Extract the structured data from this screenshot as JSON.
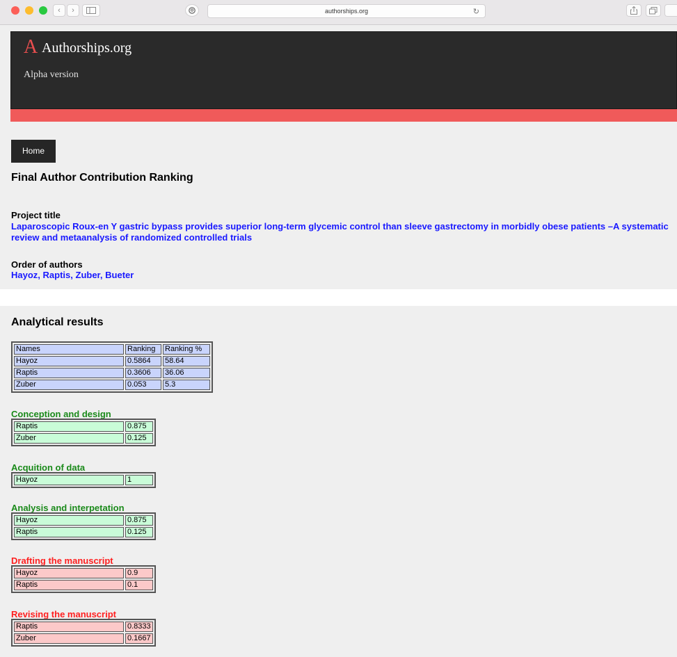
{
  "browser": {
    "url": "authorships.org",
    "nav_back": "‹",
    "nav_forward": "›",
    "reload_glyph": "↻",
    "colors": {
      "red": "#fc5f58",
      "yellow": "#fdbc2e",
      "green": "#29c940"
    }
  },
  "header": {
    "logo_letter": "A",
    "site_name": "Authorships.org",
    "subtitle": "Alpha version",
    "accent": "#f05a5a"
  },
  "nav": {
    "home_label": "Home"
  },
  "page": {
    "title": "Final Author Contribution Ranking",
    "project_label": "Project title",
    "project_title": "Laparoscopic Roux-en Y gastric bypass provides superior long-term glycemic control than sleeve gastrectomy in morbidly obese patients –A systematic review and metaanalysis of randomized controlled trials",
    "order_label": "Order of authors",
    "authors": [
      "Hayoz",
      "Raptis",
      "Zuber",
      "Bueter"
    ]
  },
  "results": {
    "title": "Analytical results",
    "ranking": {
      "headers": [
        "Names",
        "Ranking",
        "Ranking %"
      ],
      "rows": [
        [
          "Hayoz",
          "0.5864",
          "58.64"
        ],
        [
          "Raptis",
          "0.3606",
          "36.06"
        ],
        [
          "Zuber",
          "0.053",
          "5.3"
        ]
      ]
    },
    "sections": [
      {
        "title": "Conception and design",
        "rows": [
          [
            "Raptis",
            "0.875"
          ],
          [
            "Zuber",
            "0.125"
          ]
        ]
      },
      {
        "title": "Acquition of data",
        "rows": [
          [
            "Hayoz",
            "1"
          ]
        ]
      },
      {
        "title": "Analysis and interpetation",
        "rows": [
          [
            "Hayoz",
            "0.875"
          ],
          [
            "Raptis",
            "0.125"
          ]
        ]
      },
      {
        "title": "Drafting the manuscript",
        "rows": [
          [
            "Hayoz",
            "0.9"
          ],
          [
            "Raptis",
            "0.1"
          ]
        ]
      },
      {
        "title": "Revising the manuscript",
        "rows": [
          [
            "Raptis",
            "0.8333"
          ],
          [
            "Zuber",
            "0.1667"
          ]
        ]
      }
    ]
  }
}
